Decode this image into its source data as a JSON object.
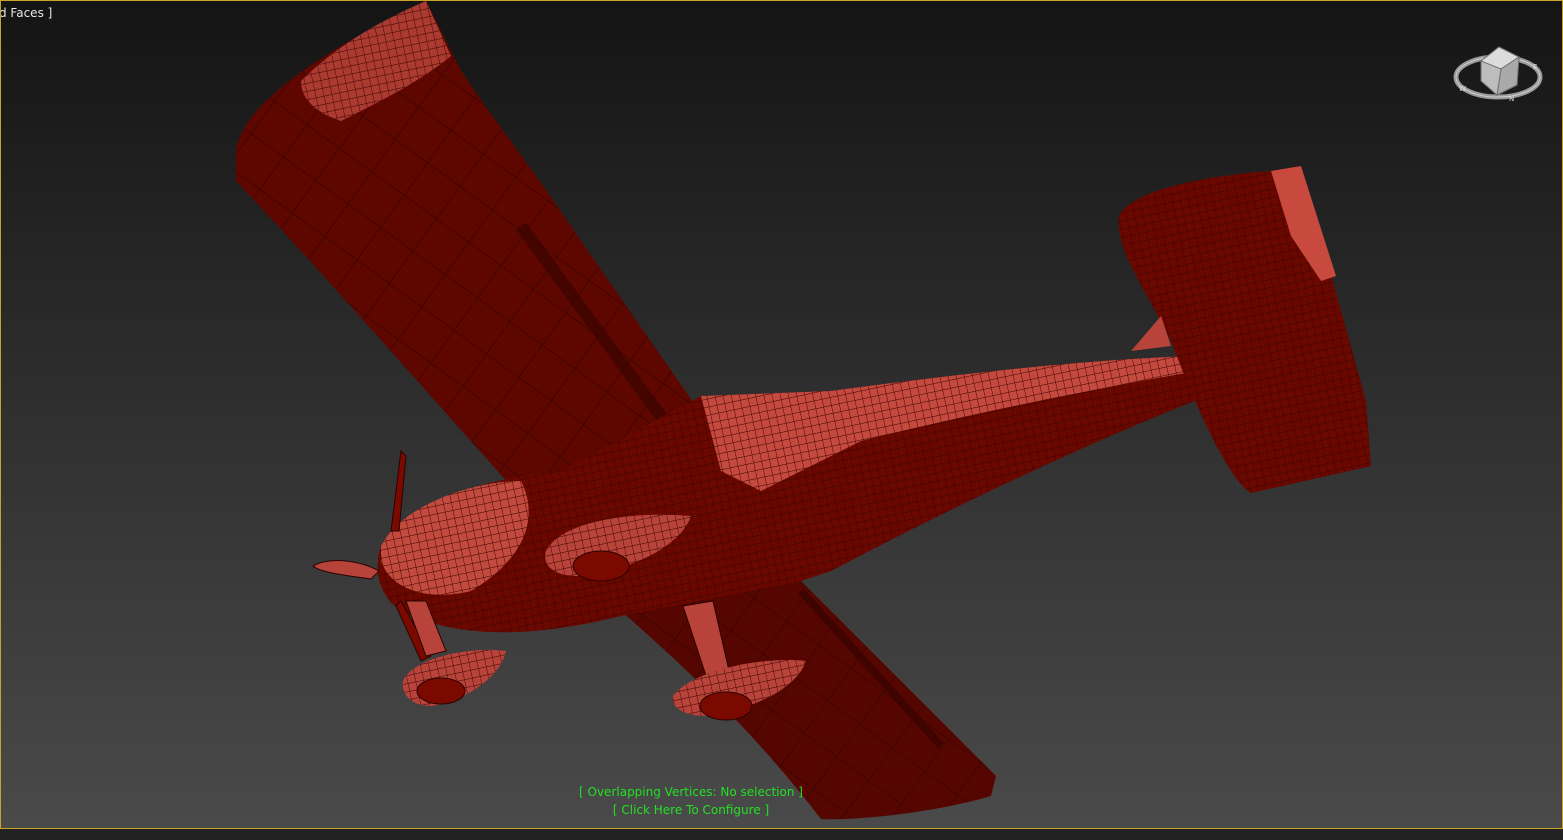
{
  "viewport": {
    "label": "d Faces ]",
    "border_color": "#c9a227",
    "model_color_dark": "#5a0600",
    "model_color_light": "#c8493d"
  },
  "viewcube": {
    "icon": "viewcube-icon"
  },
  "status": {
    "overlapping": "[ Overlapping Vertices: No selection ]",
    "configure": "[ Click Here To Configure ]",
    "color": "#22e022"
  }
}
